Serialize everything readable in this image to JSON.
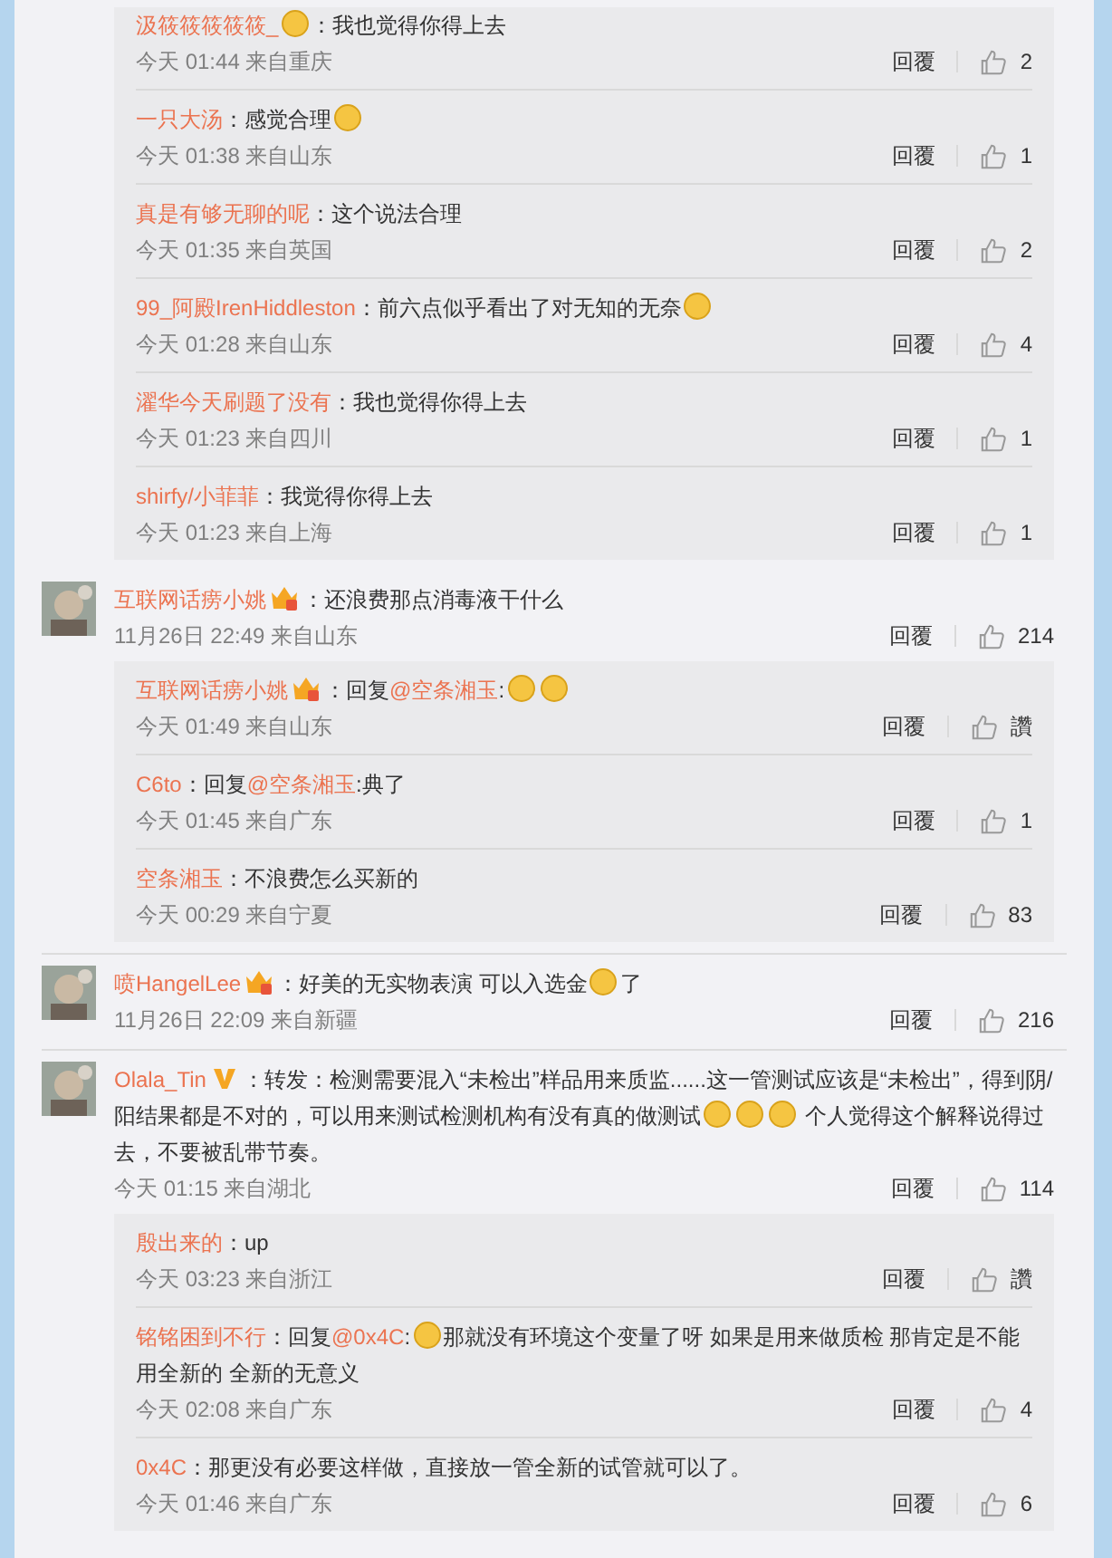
{
  "threads": [
    {
      "kind": "replies_only",
      "replies": [
        {
          "name": "汲筱筱筱筱筱_",
          "vip": false,
          "verified": false,
          "content": [
            {
              "kind": "emoji"
            },
            {
              "kind": "text",
              "text": "：我也觉得你得上去"
            }
          ],
          "time": "今天 01:44 来自重庆",
          "reply": "回覆",
          "likes": "2"
        },
        {
          "name": "一只大汤",
          "vip": false,
          "verified": false,
          "content": [
            {
              "kind": "text",
              "text": "：感觉合理"
            },
            {
              "kind": "emoji"
            }
          ],
          "time": "今天 01:38 来自山东",
          "reply": "回覆",
          "likes": "1"
        },
        {
          "name": "真是有够无聊的呢",
          "vip": false,
          "verified": false,
          "content": [
            {
              "kind": "text",
              "text": "：这个说法合理"
            }
          ],
          "time": "今天 01:35 来自英国",
          "reply": "回覆",
          "likes": "2"
        },
        {
          "name": "99_阿殿IrenHiddleston",
          "vip": false,
          "verified": false,
          "content": [
            {
              "kind": "text",
              "text": "：前六点似乎看出了对无知的无奈"
            },
            {
              "kind": "emoji"
            }
          ],
          "time": "今天 01:28 来自山东",
          "reply": "回覆",
          "likes": "4"
        },
        {
          "name": "濯华今天刷题了没有",
          "vip": false,
          "verified": false,
          "content": [
            {
              "kind": "text",
              "text": "：我也觉得你得上去"
            }
          ],
          "time": "今天 01:23 来自四川",
          "reply": "回覆",
          "likes": "1"
        },
        {
          "name": "shirfy/小菲菲",
          "vip": false,
          "verified": false,
          "content": [
            {
              "kind": "text",
              "text": "：我觉得你得上去"
            }
          ],
          "time": "今天 01:23 来自上海",
          "reply": "回覆",
          "likes": "1"
        }
      ]
    },
    {
      "kind": "comment",
      "name": "互联网话痨小姚",
      "vip": true,
      "verified": false,
      "content": [
        {
          "kind": "text",
          "text": "：还浪费那点消毒液干什么"
        }
      ],
      "time": "11月26日 22:49 来自山东",
      "reply": "回覆",
      "likes": "214",
      "replies": [
        {
          "name": "互联网话痨小姚",
          "vip": true,
          "verified": false,
          "content": [
            {
              "kind": "text",
              "text": "：回复"
            },
            {
              "kind": "mention",
              "text": "@空条湘玉"
            },
            {
              "kind": "text",
              "text": ":"
            },
            {
              "kind": "emoji"
            },
            {
              "kind": "emoji"
            }
          ],
          "time": "今天 01:49 来自山东",
          "reply": "回覆",
          "likes": "讚"
        },
        {
          "name": "C6to",
          "vip": false,
          "verified": false,
          "content": [
            {
              "kind": "text",
              "text": "：回复"
            },
            {
              "kind": "mention",
              "text": "@空条湘玉"
            },
            {
              "kind": "text",
              "text": ":典了"
            }
          ],
          "time": "今天 01:45 来自广东",
          "reply": "回覆",
          "likes": "1"
        },
        {
          "name": "空条湘玉",
          "vip": false,
          "verified": false,
          "content": [
            {
              "kind": "text",
              "text": "：不浪费怎么买新的"
            }
          ],
          "time": "今天 00:29 来自宁夏",
          "reply": "回覆",
          "likes": "83"
        }
      ]
    },
    {
      "kind": "comment",
      "name": "喷HangelLee",
      "vip": true,
      "verified": false,
      "content": [
        {
          "kind": "text",
          "text": "：好美的无实物表演 可以入选金"
        },
        {
          "kind": "emoji"
        },
        {
          "kind": "text",
          "text": "了"
        }
      ],
      "time": "11月26日 22:09 来自新疆",
      "reply": "回覆",
      "likes": "216"
    },
    {
      "kind": "comment",
      "name": "Olala_Tin",
      "vip": false,
      "verified": true,
      "content": [
        {
          "kind": "text",
          "text": "：转发：检测需要混入“未检出”样品用来质监......这一管测试应该是“未检出”，得到阴/阳结果都是不对的，可以用来测试检测机构有没有真的做测试"
        },
        {
          "kind": "emoji"
        },
        {
          "kind": "emoji"
        },
        {
          "kind": "emoji"
        },
        {
          "kind": "text",
          "text": " 个人觉得这个解释说得过去，不要被乱带节奏。"
        }
      ],
      "time": "今天 01:15 来自湖北",
      "reply": "回覆",
      "likes": "114",
      "replies": [
        {
          "name": "殷出来的",
          "vip": false,
          "verified": false,
          "content": [
            {
              "kind": "text",
              "text": "：up"
            }
          ],
          "time": "今天 03:23 来自浙江",
          "reply": "回覆",
          "likes": "讚"
        },
        {
          "name": "铭铭困到不行",
          "vip": false,
          "verified": false,
          "content": [
            {
              "kind": "text",
              "text": "：回复"
            },
            {
              "kind": "mention",
              "text": "@0x4C"
            },
            {
              "kind": "text",
              "text": ":"
            },
            {
              "kind": "emoji"
            },
            {
              "kind": "text",
              "text": "那就没有环境这个变量了呀 如果是用来做质检 那肯定是不能用全新的 全新的无意义"
            }
          ],
          "time": "今天 02:08 来自广东",
          "reply": "回覆",
          "likes": "4"
        },
        {
          "name": "0x4C",
          "vip": false,
          "verified": false,
          "content": [
            {
              "kind": "text",
              "text": "：那更没有必要这样做，直接放一管全新的试管就可以了。"
            }
          ],
          "time": "今天 01:46 来自广东",
          "reply": "回覆",
          "likes": "6"
        }
      ]
    }
  ]
}
